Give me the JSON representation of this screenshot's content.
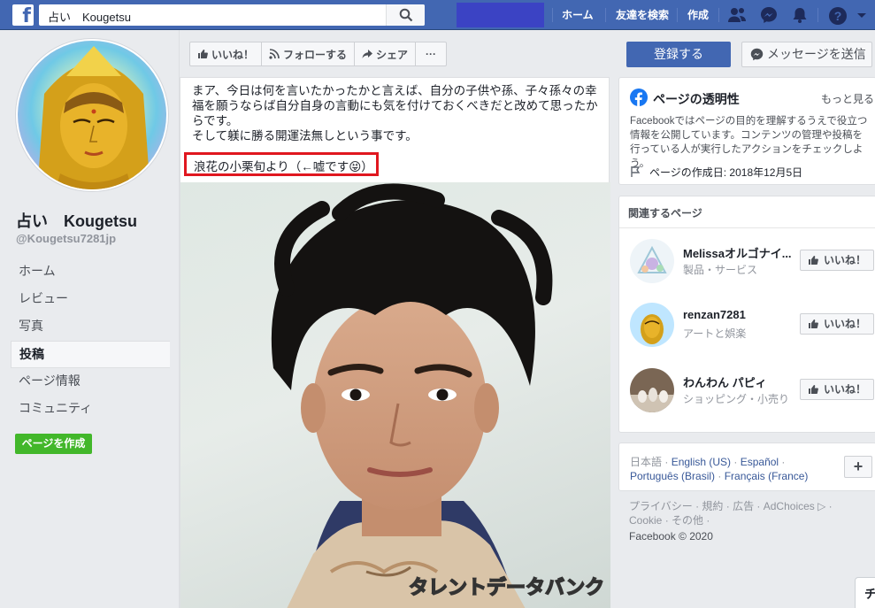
{
  "topbar": {
    "logo": "f",
    "search_value": "占い　Kougetsu",
    "nav": {
      "home": "ホーム",
      "find_friends": "友達を検索",
      "create": "作成"
    }
  },
  "page": {
    "name": "占い　Kougetsu",
    "handle": "@Kougetsu7281jp"
  },
  "left_nav": {
    "items": [
      {
        "label": "ホーム"
      },
      {
        "label": "レビュー"
      },
      {
        "label": "写真"
      },
      {
        "label": "投稿"
      },
      {
        "label": "ページ情報"
      },
      {
        "label": "コミュニティ"
      }
    ],
    "active_index": 3,
    "create_page": "ページを作成"
  },
  "actions": {
    "like": "いいね！",
    "follow": "フォローする",
    "share": "シェア",
    "more": "···"
  },
  "post": {
    "lines": [
      "まア、今日は何を言いたかったかと言えば、自分の子供や孫、子々孫々の幸",
      "福を願うならば自分自身の言動にも気を付けておくべきだと改めて思ったか",
      "らです。",
      "そして躾に勝る開運法無しという事です。"
    ],
    "highlighted": "浪花の小栗旬より（←嘘です😝）",
    "image_watermark": "タレントデータバンク"
  },
  "right": {
    "register": "登録する",
    "message": "メッセージを送信",
    "transparency": {
      "title": "ページの透明性",
      "more": "もっと見る",
      "description": "Facebookではページの目的を理解するうえで役立つ情報を公開しています。コンテンツの管理や投稿を行っている人が実行したアクションをチェックしよう。",
      "created": "ページの作成日: 2018年12月5日"
    },
    "related": {
      "title": "関連するページ",
      "items": [
        {
          "name": "Melissaオルゴナイ...",
          "category": "製品・サービス",
          "like": "いいね！"
        },
        {
          "name": "renzan7281",
          "category": "アートと娯楽",
          "like": "いいね！"
        },
        {
          "name": "わんわん パピィ",
          "category": "ショッピング・小売り",
          "like": "いいね！"
        }
      ]
    },
    "languages": {
      "current": "日本語",
      "links": [
        "English (US)",
        "Español",
        "Português (Brasil)",
        "Français (France)"
      ],
      "plus": "+"
    },
    "footer": {
      "links": "プライバシー · 規約 · 広告 · AdChoices ▷ · Cookie · その他 ·",
      "copyright": "Facebook © 2020"
    },
    "chat": "チ"
  },
  "colors": {
    "brand": "#4267b2",
    "highlight_border": "#e0171f",
    "green": "#42b72a"
  }
}
